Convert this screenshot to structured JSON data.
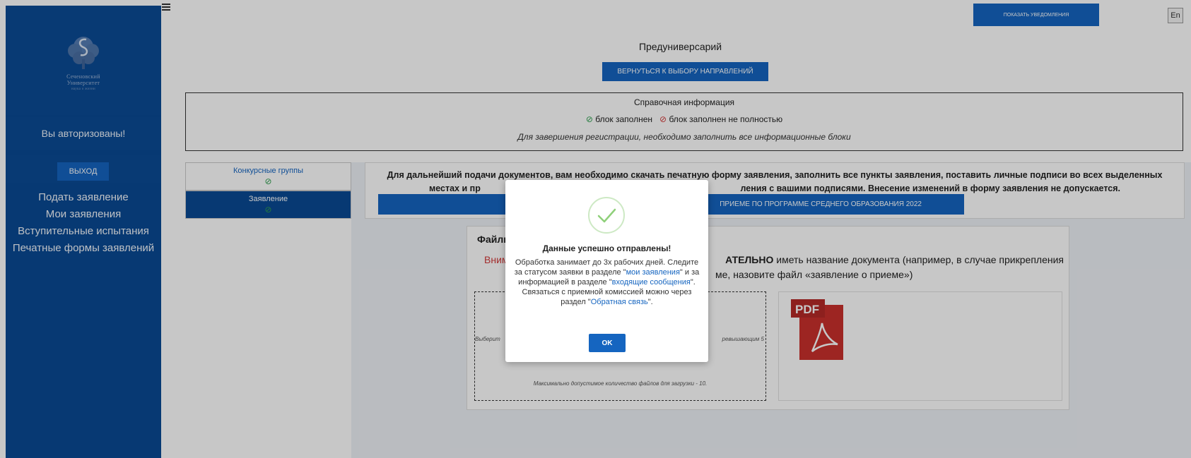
{
  "sidebar": {
    "logo_lines": [
      "Сеченовский",
      "Университет",
      "наука о жизни"
    ],
    "auth_status": "Вы авторизованы!",
    "logout_label": "выход",
    "menu": [
      {
        "label": "Подать заявление"
      },
      {
        "label": "Мои заявления"
      },
      {
        "label": "Вступительные испытания"
      },
      {
        "label": "Печатные формы заявлений"
      }
    ]
  },
  "header": {
    "notify_label": "показать уведомления",
    "lang_label": "En",
    "page_title": "Предуниверсарий",
    "back_label": "вернуться к выбору направлений"
  },
  "reference": {
    "title": "Справочная информация",
    "filled_label": "блок заполнен",
    "partial_label": "блок заполнен не полностью",
    "note": "Для завершения регистрации, необходимо заполнить все информационные блоки"
  },
  "tabs": [
    {
      "label": "Конкурсные группы"
    },
    {
      "label": "Заявление"
    }
  ],
  "instruction": {
    "line1": "Для дальнейший подачи документов, вам необходимо скачать печатную форму заявления, заполнить все пункты заявления, поставить личные подписи во всех выделенных",
    "line2_left": "местах и пр",
    "line2_right": "ления с вашими подписями. Внесение изменений в форму заявления не допускается.",
    "download_label": "приеме по программе среднего образования 2022"
  },
  "files": {
    "title": "Файлы",
    "attention_red": "Вним",
    "attention_bold": "АТЕЛЬНО",
    "attention_line1_rest": " иметь название документа (например, в случае прикрепления",
    "attention_line2": "ме, назовите файл «заявление о приеме»)",
    "drop_hint_left": "Выберит",
    "drop_hint_right": "ревышающим 5",
    "drop_max": "Максимально допустимое количество файлов для загрузки - 10.",
    "pdf_label": "PDF"
  },
  "modal": {
    "title": "Данные успешно отправлены!",
    "body_1": "Обработка занимает до 3х рабочих дней. Следите за статусом заявки в разделе \"",
    "link_1": "мои заявления",
    "body_2": "\" и за информацией в разделе \"",
    "link_2": "входящие сообщения",
    "body_3": "\". Связаться с приемной комиссией можно через раздел \"",
    "link_3": "Обратная связь",
    "body_4": "\".",
    "ok_label": "ok"
  },
  "colors": {
    "sidebar": "#0a4a94",
    "accent": "#1565c0",
    "success": "#2e9e4e",
    "error": "#d23a3a"
  }
}
